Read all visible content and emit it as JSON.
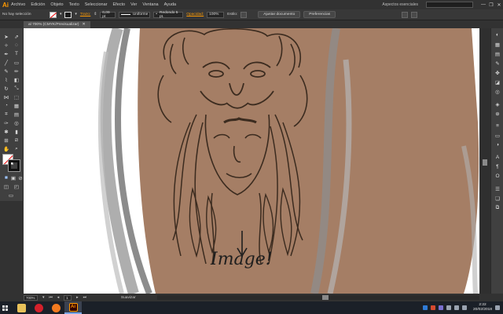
{
  "app": {
    "logo": "Ai",
    "menu": [
      "Archivo",
      "Edición",
      "Objeto",
      "Texto",
      "Seleccionar",
      "Efecto",
      "Ver",
      "Ventana",
      "Ayuda"
    ],
    "workspace": "Aspectos esenciales",
    "window_controls": [
      "—",
      "❐",
      "✕"
    ]
  },
  "control_bar": {
    "selection_status": "No hay selección",
    "stroke_label": "Trazo:",
    "stroke_weight": "0,09 pt",
    "profile_label": "Uniforme",
    "brush_label": "Redondo 5 pt.",
    "opacity_label": "Opacidad:",
    "opacity_value": "100%",
    "style_label": "Estilo:",
    "doc_setup_button": "Ajustar documento",
    "preferences_button": "Preferencias"
  },
  "document": {
    "tab_title": "al 700% (CMYK/Previsualizar)",
    "tab_close": "✕"
  },
  "artwork": {
    "annotation_text": "Image!",
    "skin_color": "#a57e65",
    "ink_color": "#3b2b1f"
  },
  "status_bar": {
    "zoom": "700%",
    "page": "1",
    "tool_name": "Suavizar"
  },
  "taskbar": {
    "time": "2:22",
    "date": "20/02/2018",
    "active_app_label": "Ai"
  }
}
